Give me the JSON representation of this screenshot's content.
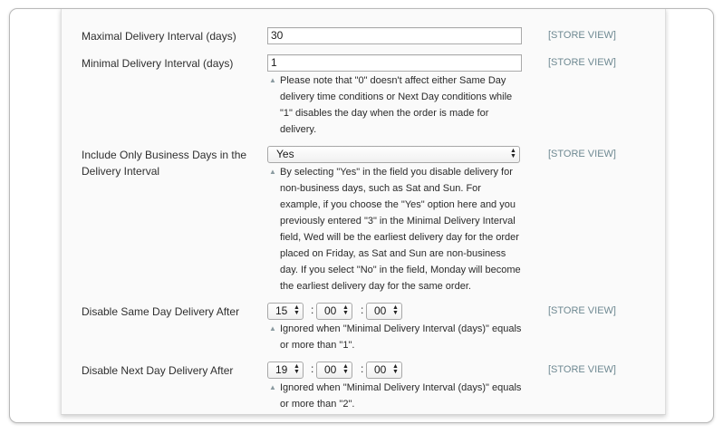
{
  "scope_label": "[STORE VIEW]",
  "fields": {
    "max_interval": {
      "label": "Maximal Delivery Interval (days)",
      "value": "30"
    },
    "min_interval": {
      "label": "Minimal Delivery Interval (days)",
      "value": "1",
      "note_lines": [
        "Please note that \"0\" doesn't affect either Same Day",
        "delivery time conditions or Next Day conditions while",
        "\"1\" disables the day when the order is made for",
        "delivery."
      ]
    },
    "business_days": {
      "label_lines": [
        "Include Only Business Days in the",
        "Delivery Interval"
      ],
      "selected": "Yes",
      "note_lines": [
        "By selecting \"Yes\" in the field you disable delivery for",
        "non-business days, such as Sat and Sun. For",
        "example, if you choose the \"Yes\" option here and you",
        "previously entered \"3\" in the Minimal Delivery Interval",
        "field, Wed will be the earliest delivery day for the order",
        "placed on Friday, as Sat and Sun are non-business",
        "day. If you select \"No\" in the field, Monday will become",
        "the earliest delivery day for the same order."
      ]
    },
    "same_day": {
      "label": "Disable Same Day Delivery After",
      "hour": "15",
      "minute": "00",
      "second": "00",
      "note_lines": [
        "Ignored when \"Minimal Delivery Interval (days)\" equals",
        "or more than \"1\"."
      ]
    },
    "next_day": {
      "label": "Disable Next Day Delivery After",
      "hour": "19",
      "minute": "00",
      "second": "00",
      "note_lines": [
        "Ignored when \"Minimal Delivery Interval (days)\" equals",
        "or more than \"2\"."
      ]
    }
  },
  "icons": {
    "note": "note-triangle-icon",
    "select_arrows": "up-down-arrows-icon"
  }
}
